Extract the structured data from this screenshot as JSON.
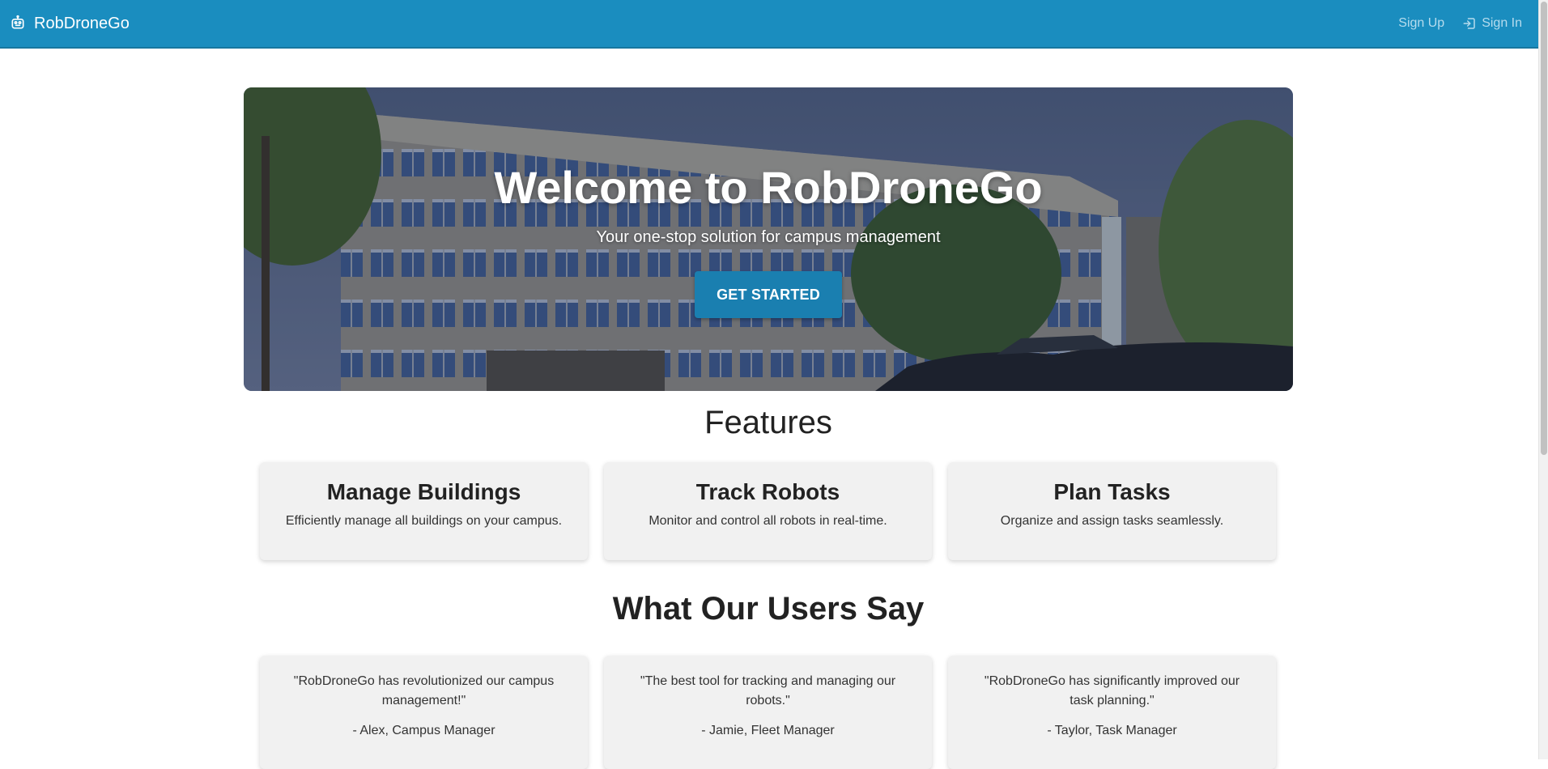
{
  "header": {
    "brand": "RobDroneGo",
    "signup_label": "Sign Up",
    "signin_label": "Sign In",
    "brand_icon": "robot-icon",
    "signin_icon": "login-icon",
    "bar_color": "#1a8dbf"
  },
  "hero": {
    "title": "Welcome to RobDroneGo",
    "subtitle": "Your one-stop solution for campus management",
    "cta_label": "GET STARTED",
    "cta_color": "#1a7fb0"
  },
  "features": {
    "heading": "Features",
    "items": [
      {
        "title": "Manage Buildings",
        "description": "Efficiently manage all buildings on your campus."
      },
      {
        "title": "Track Robots",
        "description": "Monitor and control all robots in real-time."
      },
      {
        "title": "Plan Tasks",
        "description": "Organize and assign tasks seamlessly."
      }
    ]
  },
  "testimonials": {
    "heading": "What Our Users Say",
    "items": [
      {
        "quote": "\"RobDroneGo has revolutionized our campus management!\"",
        "author": "- Alex, Campus Manager"
      },
      {
        "quote": "\"The best tool for tracking and managing our robots.\"",
        "author": "- Jamie, Fleet Manager"
      },
      {
        "quote": "\"RobDroneGo has significantly improved our task planning.\"",
        "author": "- Taylor, Task Manager"
      }
    ]
  }
}
